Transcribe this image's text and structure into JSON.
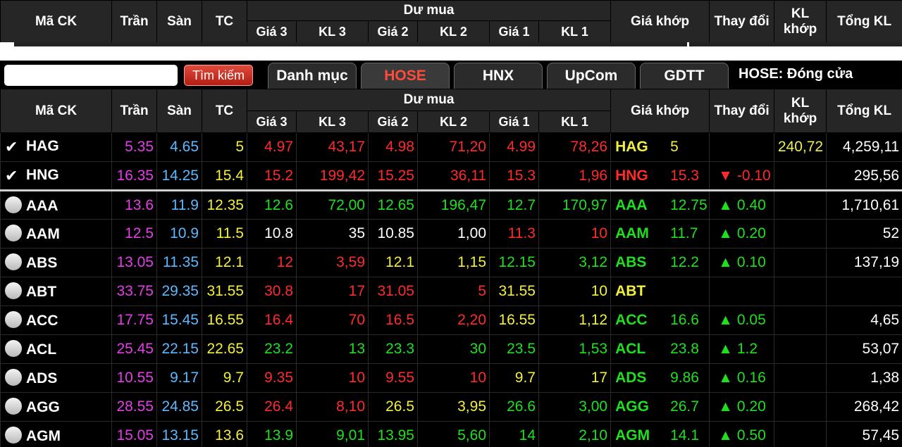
{
  "header": {
    "ma_ck": "Mã CK",
    "tran": "Trần",
    "san": "Sàn",
    "tc": "TC",
    "du_mua": "Dư mua",
    "gia3": "Giá 3",
    "kl3": "KL 3",
    "gia2": "Giá 2",
    "kl2": "KL 2",
    "gia1": "Giá 1",
    "kl1": "KL 1",
    "gia_khop": "Giá khớp",
    "thay_doi": "Thay đổi",
    "kl_khop": "KL khớp",
    "tong_kl": "Tổng KL"
  },
  "toolbar": {
    "search_placeholder": "",
    "search_button": "Tìm kiếm",
    "tabs": [
      "Danh mục",
      "HOSE",
      "HNX",
      "UpCom",
      "GDTT"
    ],
    "status": "HOSE:  Đóng cửa"
  },
  "colors": {
    "ceiling": "#e23fe6",
    "floor": "#5cb8ff",
    "reference": "#f2ef3e",
    "down": "#ff2b2b",
    "up": "#1fe01f",
    "active_tab": "#ff4b3a"
  },
  "rows": [
    {
      "checked": true,
      "sym": "HAG",
      "tran": "5.35",
      "san": "4.65",
      "tc": "5",
      "g3": "4.97",
      "k3": "43,17",
      "g2": "4.98",
      "k2": "71,20",
      "g1": "4.99",
      "k1": "78,26",
      "gk": "5",
      "arrow": "",
      "td": "",
      "kl": "240,72",
      "tong": "4,259,11",
      "cls": {
        "g3": "red",
        "k3": "red",
        "g2": "red",
        "k2": "red",
        "g1": "red",
        "k1": "red",
        "gk": "yellow",
        "td": "white",
        "kl": "lyellow"
      }
    },
    {
      "checked": true,
      "sym": "HNG",
      "tran": "16.35",
      "san": "14.25",
      "tc": "15.4",
      "g3": "15.2",
      "k3": "199,42",
      "g2": "15.25",
      "k2": "36,11",
      "g1": "15.3",
      "k1": "1,96",
      "gk": "15.3",
      "arrow": "▼",
      "td": "-0.10",
      "kl": "",
      "tong": "295,56",
      "cls": {
        "g3": "red",
        "k3": "red",
        "g2": "red",
        "k2": "red",
        "g1": "red",
        "k1": "red",
        "gk": "red",
        "td": "red",
        "kl": "white"
      }
    },
    {
      "checked": false,
      "sym": "AAA",
      "tran": "13.6",
      "san": "11.9",
      "tc": "12.35",
      "g3": "12.6",
      "k3": "72,00",
      "g2": "12.65",
      "k2": "196,47",
      "g1": "12.7",
      "k1": "170,97",
      "gk": "12.75",
      "arrow": "▲",
      "td": "0.40",
      "kl": "",
      "tong": "1,710,61",
      "cls": {
        "g3": "green",
        "k3": "green",
        "g2": "green",
        "k2": "green",
        "g1": "green",
        "k1": "green",
        "gk": "green",
        "td": "green",
        "kl": "white"
      }
    },
    {
      "checked": false,
      "sym": "AAM",
      "tran": "12.5",
      "san": "10.9",
      "tc": "11.5",
      "g3": "10.8",
      "k3": "35",
      "g2": "10.85",
      "k2": "1,00",
      "g1": "11.3",
      "k1": "10",
      "gk": "11.7",
      "arrow": "▲",
      "td": "0.20",
      "kl": "",
      "tong": "52",
      "cls": {
        "g3": "white",
        "k3": "white",
        "g2": "white",
        "k2": "white",
        "g1": "red",
        "k1": "red",
        "gk": "green",
        "td": "green",
        "kl": "white"
      }
    },
    {
      "checked": false,
      "sym": "ABS",
      "tran": "13.05",
      "san": "11.35",
      "tc": "12.1",
      "g3": "12",
      "k3": "3,59",
      "g2": "12.1",
      "k2": "1,15",
      "g1": "12.15",
      "k1": "3,12",
      "gk": "12.2",
      "arrow": "▲",
      "td": "0.10",
      "kl": "",
      "tong": "137,19",
      "cls": {
        "g3": "red",
        "k3": "red",
        "g2": "yellow",
        "k2": "yellow",
        "g1": "green",
        "k1": "green",
        "gk": "green",
        "td": "green",
        "kl": "white"
      }
    },
    {
      "checked": false,
      "sym": "ABT",
      "tran": "33.75",
      "san": "29.35",
      "tc": "31.55",
      "g3": "30.8",
      "k3": "17",
      "g2": "31.05",
      "k2": "5",
      "g1": "31.55",
      "k1": "10",
      "gk": "",
      "arrow": "",
      "td": "",
      "kl": "",
      "tong": "",
      "cls": {
        "g3": "red",
        "k3": "red",
        "g2": "red",
        "k2": "red",
        "g1": "yellow",
        "k1": "yellow",
        "gk": "yellow",
        "td": "white",
        "kl": "white"
      }
    },
    {
      "checked": false,
      "sym": "ACC",
      "tran": "17.75",
      "san": "15.45",
      "tc": "16.55",
      "g3": "16.4",
      "k3": "70",
      "g2": "16.5",
      "k2": "2,20",
      "g1": "16.55",
      "k1": "1,12",
      "gk": "16.6",
      "arrow": "▲",
      "td": "0.05",
      "kl": "",
      "tong": "4,65",
      "cls": {
        "g3": "red",
        "k3": "red",
        "g2": "red",
        "k2": "red",
        "g1": "yellow",
        "k1": "yellow",
        "gk": "green",
        "td": "green",
        "kl": "white"
      }
    },
    {
      "checked": false,
      "sym": "ACL",
      "tran": "25.45",
      "san": "22.15",
      "tc": "22.65",
      "g3": "23.2",
      "k3": "13",
      "g2": "23.3",
      "k2": "30",
      "g1": "23.5",
      "k1": "1,53",
      "gk": "23.8",
      "arrow": "▲",
      "td": "1.2",
      "kl": "",
      "tong": "53,07",
      "cls": {
        "g3": "green",
        "k3": "green",
        "g2": "green",
        "k2": "green",
        "g1": "green",
        "k1": "green",
        "gk": "green",
        "td": "green",
        "kl": "white"
      }
    },
    {
      "checked": false,
      "sym": "ADS",
      "tran": "10.55",
      "san": "9.17",
      "tc": "9.7",
      "g3": "9.35",
      "k3": "10",
      "g2": "9.55",
      "k2": "10",
      "g1": "9.7",
      "k1": "17",
      "gk": "9.86",
      "arrow": "▲",
      "td": "0.16",
      "kl": "",
      "tong": "1,38",
      "cls": {
        "g3": "red",
        "k3": "red",
        "g2": "red",
        "k2": "red",
        "g1": "yellow",
        "k1": "yellow",
        "gk": "green",
        "td": "green",
        "kl": "white"
      }
    },
    {
      "checked": false,
      "sym": "AGG",
      "tran": "28.55",
      "san": "24.85",
      "tc": "26.5",
      "g3": "26.4",
      "k3": "8,10",
      "g2": "26.5",
      "k2": "3,95",
      "g1": "26.6",
      "k1": "3,00",
      "gk": "26.7",
      "arrow": "▲",
      "td": "0.20",
      "kl": "",
      "tong": "268,42",
      "cls": {
        "g3": "red",
        "k3": "red",
        "g2": "yellow",
        "k2": "yellow",
        "g1": "green",
        "k1": "green",
        "gk": "green",
        "td": "green",
        "kl": "white"
      }
    },
    {
      "checked": false,
      "sym": "AGM",
      "tran": "15.05",
      "san": "13.15",
      "tc": "13.6",
      "g3": "13.9",
      "k3": "9,01",
      "g2": "13.95",
      "k2": "5,60",
      "g1": "14",
      "k1": "2,10",
      "gk": "14.1",
      "arrow": "▲",
      "td": "0.50",
      "kl": "",
      "tong": "57,45",
      "cls": {
        "g3": "green",
        "k3": "green",
        "g2": "green",
        "k2": "green",
        "g1": "green",
        "k1": "green",
        "gk": "green",
        "td": "green",
        "kl": "white"
      }
    }
  ]
}
